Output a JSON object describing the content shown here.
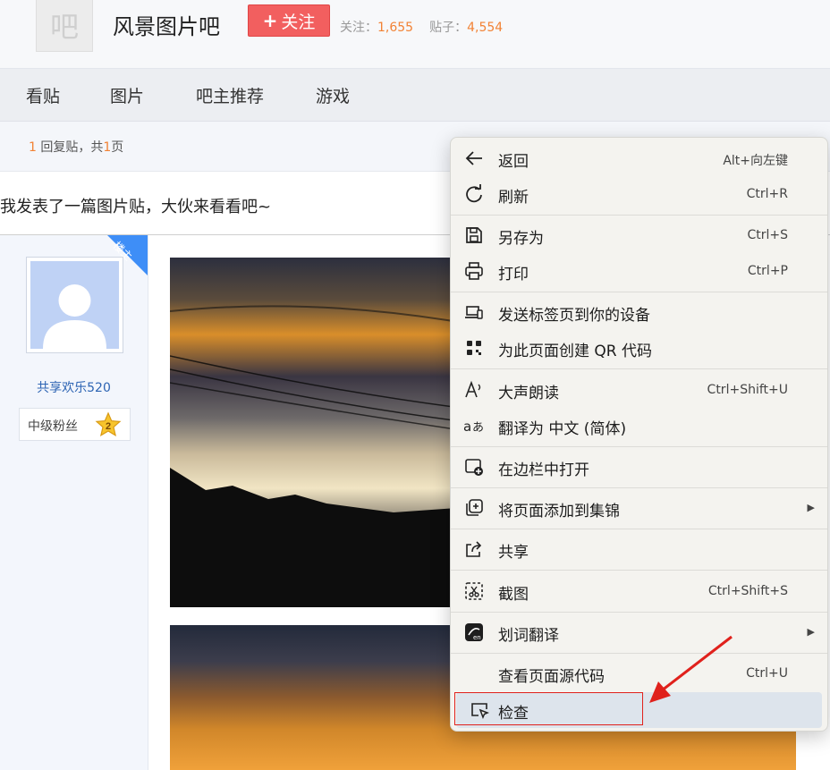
{
  "header": {
    "logo_char": "吧",
    "forum_name": "风景图片吧",
    "follow_plus": "+",
    "follow_label": "关注",
    "follows_label": "关注：",
    "follows_count": "1,655",
    "posts_label": "贴子：",
    "posts_count": "4,554"
  },
  "nav": {
    "tabs": [
      "看贴",
      "图片",
      "吧主推荐",
      "游戏"
    ]
  },
  "pager": {
    "replies": "1",
    "replies_text": " 回复贴，共",
    "pages": "1",
    "pages_text": "页"
  },
  "post": {
    "title": "我发表了一篇图片贴，大伙来看看吧~",
    "louzhu_badge": "楼主",
    "username": "共享欢乐520",
    "fan_label": "中级粉丝",
    "fan_level": "2"
  },
  "context_menu": {
    "items": [
      {
        "label": "返回",
        "shortcut": "Alt+向左键",
        "icon": "back-arrow-icon"
      },
      {
        "label": "刷新",
        "shortcut": "Ctrl+R",
        "icon": "refresh-icon"
      },
      {
        "label": "另存为",
        "shortcut": "Ctrl+S",
        "icon": "save-icon"
      },
      {
        "label": "打印",
        "shortcut": "Ctrl+P",
        "icon": "printer-icon"
      },
      {
        "label": "发送标签页到你的设备",
        "shortcut": "",
        "icon": "devices-icon"
      },
      {
        "label": "为此页面创建 QR 代码",
        "shortcut": "",
        "icon": "qr-code-icon"
      },
      {
        "label": "大声朗读",
        "shortcut": "Ctrl+Shift+U",
        "icon": "read-aloud-icon"
      },
      {
        "label": "翻译为 中文 (简体)",
        "shortcut": "",
        "icon": "translate-icon"
      },
      {
        "label": "在边栏中打开",
        "shortcut": "",
        "icon": "sidebar-open-icon"
      },
      {
        "label": "将页面添加到集锦",
        "shortcut": "",
        "icon": "collections-add-icon"
      },
      {
        "label": "共享",
        "shortcut": "",
        "icon": "share-icon"
      },
      {
        "label": "截图",
        "shortcut": "Ctrl+Shift+S",
        "icon": "screenshot-icon"
      },
      {
        "label": "划词翻译",
        "shortcut": "",
        "icon": "word-translate-icon"
      },
      {
        "label": "查看页面源代码",
        "shortcut": "Ctrl+U",
        "icon": ""
      },
      {
        "label": "检查",
        "shortcut": "",
        "icon": "inspect-icon"
      }
    ]
  },
  "colors": {
    "follow_button": "#f25f5f",
    "count_accent": "#f28234",
    "username": "#2d64b3",
    "louzhu_badge": "#3e8ef7",
    "annotation": "#e0211c"
  }
}
